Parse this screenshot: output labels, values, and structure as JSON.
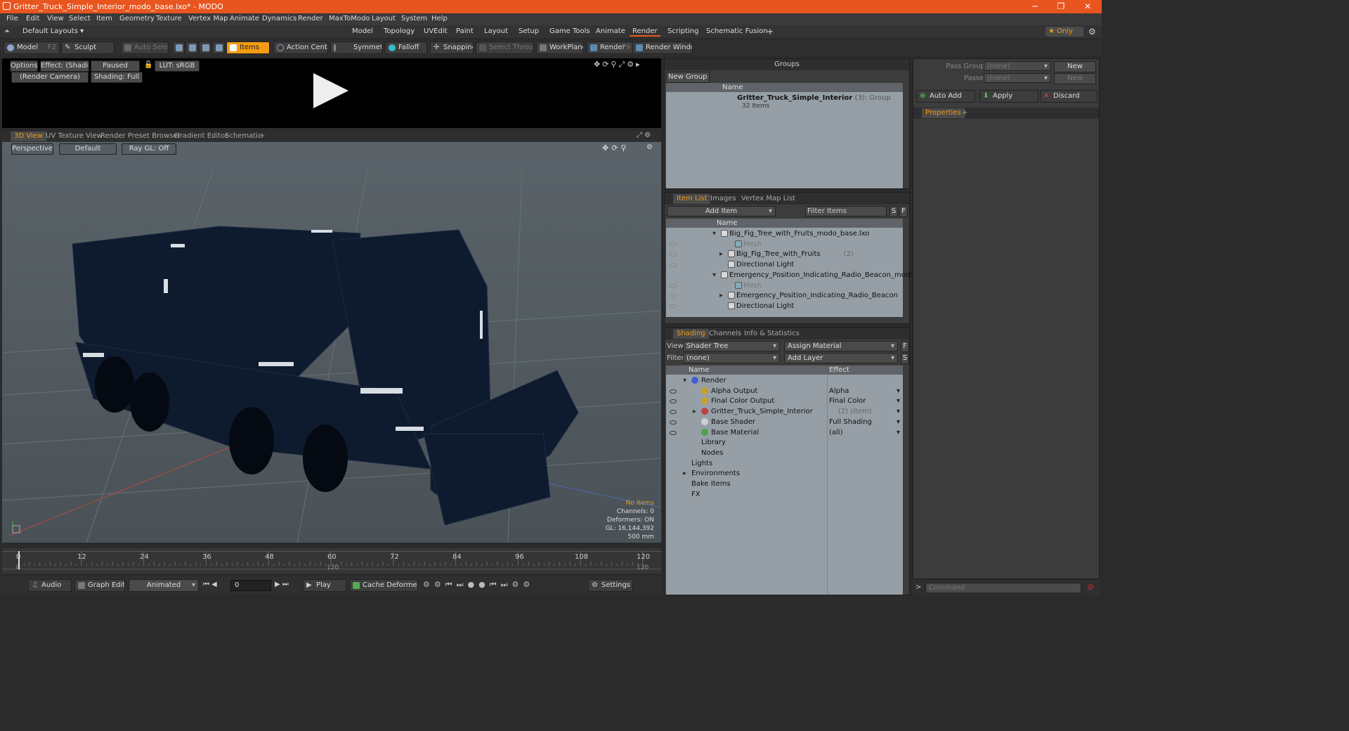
{
  "window": {
    "title": "Gritter_Truck_Simple_Interior_modo_base.lxo* - MODO",
    "min": "─",
    "max": "❐",
    "close": "✕"
  },
  "menu": [
    "File",
    "Edit",
    "View",
    "Select",
    "Item",
    "Geometry",
    "Texture",
    "Vertex Map",
    "Animate",
    "Dynamics",
    "Render",
    "MaxToModo",
    "Layout",
    "System",
    "Help"
  ],
  "layout": {
    "preset": "Default Layouts ▾",
    "tabs": [
      "Model",
      "Topology",
      "UVEdit",
      "Paint",
      "Layout",
      "Setup",
      "Game Tools",
      "Animate",
      "Render",
      "Scripting",
      "Schematic Fusion"
    ],
    "selected": "Render",
    "add": "+",
    "only": "★ Only"
  },
  "toolbar": {
    "model": "Model",
    "model_key": "F2",
    "sculpt": "Sculpt",
    "auto_select": "Auto Select",
    "items": "Items",
    "action_center": "Action Center",
    "symmetry": "Symmetry",
    "falloff": "Falloff",
    "snapping": "Snapping",
    "select_through": "Select Through",
    "workplane": "WorkPlane",
    "render": "Render",
    "render_key": "F9",
    "render_window": "Render Window"
  },
  "preview": {
    "options": "Options",
    "effect": "Effect: (Shadi...",
    "paused": "Paused",
    "lut": "LUT: sRGB",
    "camera": "(Render Camera)",
    "shading": "Shading: Full"
  },
  "viewport_tabs": [
    "3D View",
    "UV Texture View",
    "Render Preset Browser",
    "Gradient Editor",
    "Schematic"
  ],
  "viewport": {
    "add": "+",
    "perspective": "Perspective",
    "default": "Default",
    "raygl": "Ray GL: Off",
    "no_items": "No Items",
    "channels": "Channels: 0",
    "deformers": "Deformers: ON",
    "gl": "GL: 16,144,392",
    "scale": "500 mm"
  },
  "timeline": {
    "ticks": [
      "0",
      "12",
      "24",
      "36",
      "48",
      "60",
      "72",
      "84",
      "96",
      "108",
      "120"
    ],
    "bottom_left": "0",
    "bottom_mid": "120",
    "bottom_right": "120"
  },
  "transport": {
    "audio": "Audio",
    "graph_editor": "Graph Editor",
    "animated": "Animated",
    "frame": "0",
    "play": "Play",
    "cache": "Cache Deformers",
    "settings": "Settings"
  },
  "groups": {
    "title": "Groups",
    "new_group": "New Group",
    "col_name": "Name",
    "item_name": "Gritter_Truck_Simple_Interior",
    "item_count": "(3)",
    "item_type": ": Group",
    "item_sub": "32 Items"
  },
  "itemlist": {
    "tabs": [
      "Item List",
      "Images",
      "Vertex Map List"
    ],
    "add_item": "Add Item",
    "filter": "Filter Items",
    "s": "S",
    "f": "F",
    "col_name": "Name",
    "rows": [
      {
        "label": "Big_Fig_Tree_with_Fruits_modo_base.lxo",
        "indent": 0,
        "exp": "▾",
        "dim": false,
        "extra": ""
      },
      {
        "label": "Mesh",
        "indent": 2,
        "exp": "",
        "dim": true,
        "extra": ""
      },
      {
        "label": "Big_Fig_Tree_with_Fruits",
        "indent": 1,
        "exp": "▸",
        "dim": false,
        "extra": "(2)"
      },
      {
        "label": "Directional Light",
        "indent": 1,
        "exp": "",
        "dim": false,
        "extra": ""
      },
      {
        "label": "Emergency_Position_Indicating_Radio_Beacon_modo_bas ...",
        "indent": 0,
        "exp": "▾",
        "dim": false,
        "extra": ""
      },
      {
        "label": "Mesh",
        "indent": 2,
        "exp": "",
        "dim": true,
        "extra": ""
      },
      {
        "label": "Emergency_Position_Indicating_Radio_Beacon",
        "indent": 1,
        "exp": "▸",
        "dim": false,
        "extra": "(2)"
      },
      {
        "label": "Directional Light",
        "indent": 1,
        "exp": "",
        "dim": false,
        "extra": ""
      }
    ]
  },
  "shading": {
    "tabs": [
      "Shading",
      "Channels",
      "Info & Statistics"
    ],
    "view_label": "View",
    "view": "Shader Tree",
    "assign": "Assign Material",
    "filter_label": "Filter",
    "filter": "(none)",
    "add_layer": "Add Layer",
    "f": "F",
    "s": "S",
    "col_name": "Name",
    "col_effect": "Effect",
    "rows": [
      {
        "label": "Render",
        "effect": "",
        "indent": 0,
        "exp": "▾",
        "color": "#4060d0",
        "eye": false,
        "extra": ""
      },
      {
        "label": "Alpha Output",
        "effect": "Alpha",
        "indent": 1,
        "exp": "",
        "color": "#c8a030",
        "eye": true,
        "extra": ""
      },
      {
        "label": "Final Color Output",
        "effect": "Final Color",
        "indent": 1,
        "exp": "",
        "color": "#c8a030",
        "eye": true,
        "extra": ""
      },
      {
        "label": "Gritter_Truck_Simple_Interior",
        "effect": "",
        "indent": 1,
        "exp": "▸",
        "color": "#c04040",
        "eye": true,
        "extra": "(2) (Item)"
      },
      {
        "label": "Base Shader",
        "effect": "Full Shading",
        "indent": 1,
        "exp": "",
        "color": "#d0d0d0",
        "eye": true,
        "extra": ""
      },
      {
        "label": "Base Material",
        "effect": "(all)",
        "indent": 1,
        "exp": "",
        "color": "#50a050",
        "eye": true,
        "extra": ""
      },
      {
        "label": "Library",
        "effect": "",
        "indent": 1,
        "exp": "",
        "color": "",
        "eye": false,
        "extra": ""
      },
      {
        "label": "Nodes",
        "effect": "",
        "indent": 1,
        "exp": "",
        "color": "",
        "eye": false,
        "extra": ""
      },
      {
        "label": "Lights",
        "effect": "",
        "indent": 0,
        "exp": "",
        "color": "",
        "eye": false,
        "extra": ""
      },
      {
        "label": "Environments",
        "effect": "",
        "indent": 0,
        "exp": "▸",
        "color": "",
        "eye": false,
        "extra": ""
      },
      {
        "label": "Bake Items",
        "effect": "",
        "indent": 0,
        "exp": "",
        "color": "",
        "eye": false,
        "extra": ""
      },
      {
        "label": "FX",
        "effect": "",
        "indent": 0,
        "exp": "",
        "color": "",
        "eye": false,
        "extra": ""
      }
    ]
  },
  "passes": {
    "pass_groups": "Pass Groups",
    "passes": "Passes",
    "none": "(none)",
    "new": "New",
    "auto_add": "Auto Add",
    "apply": "Apply",
    "discard": "Discard",
    "properties": "Properties",
    "add": "+"
  },
  "command": {
    "placeholder": "Command",
    "prompt": ">"
  }
}
